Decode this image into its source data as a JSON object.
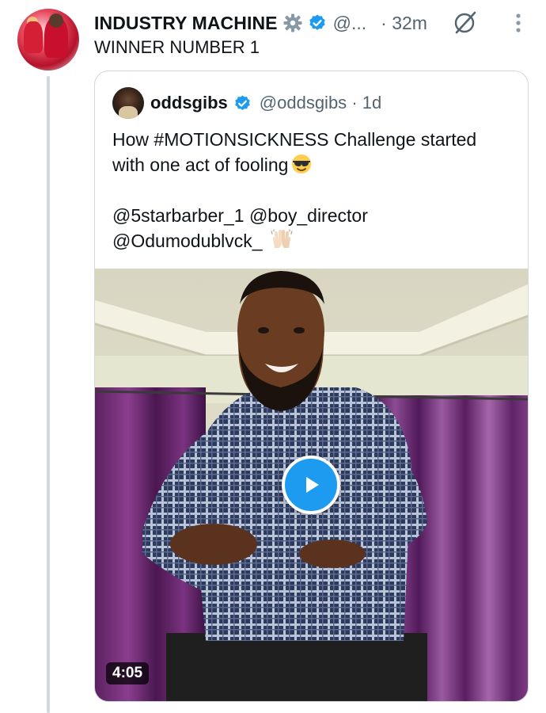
{
  "tweet": {
    "author_name": "INDUSTRY MACHINE",
    "handle": "@...",
    "time": "32m",
    "separator": "·",
    "text": "WINNER NUMBER 1",
    "icons": {
      "badge": "gear-badge-icon",
      "verified": "verified-icon",
      "grok": "grok-icon",
      "more": "more-options-icon"
    }
  },
  "quoted": {
    "author_name": "oddsgibs",
    "handle": "@oddsgibs",
    "separator": "·",
    "time": "1d",
    "line1": "How #MOTIONSICKNESS Challenge started",
    "line2": "with one act of fooling",
    "line2_emoji": "smiling-face-with-sunglasses-emoji",
    "line3": "@5starbarber_1  @boy_director",
    "line4": "@Odumodublvck_",
    "line4_emoji": "raising-hands-emoji",
    "video": {
      "duration": "4:05",
      "play_icon": "play-icon"
    }
  },
  "colors": {
    "accent": "#1d9bf0",
    "muted_text": "#536471",
    "border": "#cfd9de",
    "curtain": "#6b2a6f"
  }
}
